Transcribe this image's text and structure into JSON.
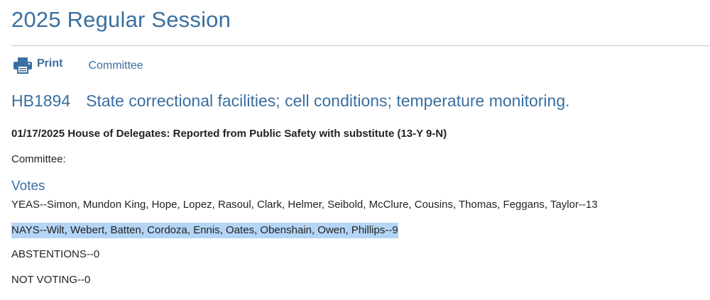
{
  "session_title": "2025 Regular Session",
  "toolbar": {
    "print_label": "Print",
    "committee_label": "Committee"
  },
  "bill": {
    "number": "HB1894",
    "title": "State correctional facilities; cell conditions; temperature monitoring."
  },
  "action": "01/17/2025 House of Delegates: Reported from Public Safety with substitute (13-Y 9-N)",
  "committee_label": "Committee:",
  "votes": {
    "heading": "Votes",
    "yeas": "YEAS--Simon, Mundon King, Hope, Lopez, Rasoul, Clark, Helmer, Seibold, McClure, Cousins, Thomas, Feggans, Taylor--13",
    "nays": "NAYS--Wilt, Webert, Batten, Cordoza, Ennis, Oates, Obenshain, Owen, Phillips--9",
    "abstentions": "ABSTENTIONS--0",
    "not_voting": "NOT VOTING--0"
  },
  "colors": {
    "link_blue": "#3a6fa0",
    "selection_highlight": "#b4d5f5"
  },
  "icons": {
    "print": "printer-icon"
  }
}
